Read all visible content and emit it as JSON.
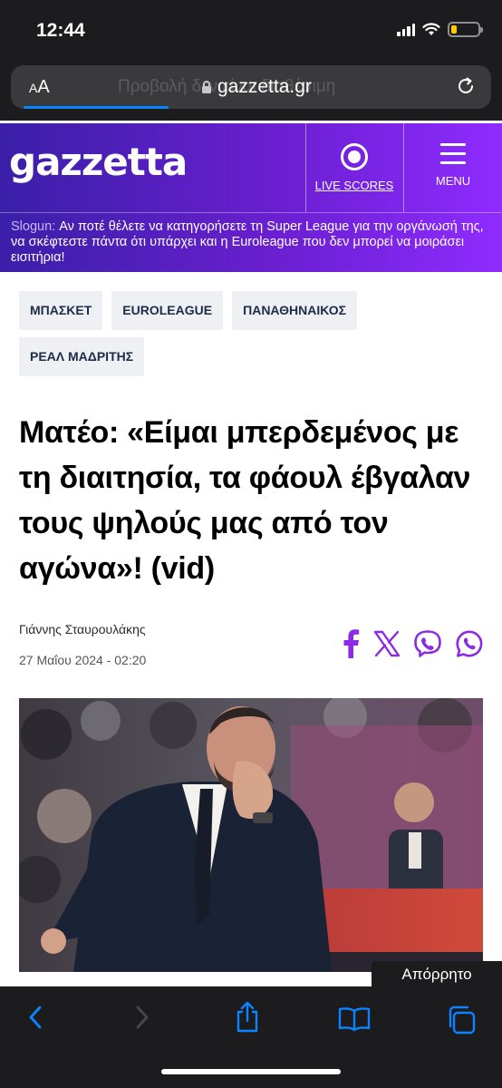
{
  "status_bar": {
    "time": "12:44"
  },
  "browser": {
    "text_size_label": "AA",
    "ghost_text": "Προβολή δεν είναι διαθέσιμη",
    "url": "gazzetta.gr",
    "accent_color": "#0a84ff"
  },
  "site": {
    "logo_text": "gazzetta",
    "live_scores_label": "LIVE SCORES",
    "menu_label": "MENU",
    "slogan_label": "Slogun:",
    "slogan_text": "Αν ποτέ θέλετε να κατηγορήσετε τη Super League για την οργάνωσή της, να σκέφτεστε πάντα ότι υπάρχει και η Euroleague που δεν μπορεί να μοιράσει εισιτήρια!",
    "brand_colors": [
      "#3a1fa8",
      "#8f2bff"
    ]
  },
  "tags": [
    "ΜΠΑΣΚΕΤ",
    "EUROLEAGUE",
    "ΠΑΝΑΘΗΝΑΙΚΟΣ",
    "ΡΕΑΛ ΜΑΔΡΙΤΗΣ"
  ],
  "article": {
    "headline": "Ματέο: «Είμαι μπερδεμένος με τη διαιτησία, τα φάουλ έβγαλαν τους ψηλούς μας από τον αγώνα»! (vid)",
    "author": "Γιάννης Σταυρουλάκης",
    "date": "27 Μαΐου 2024 - 02:20",
    "share_icons": [
      "facebook-icon",
      "x-icon",
      "viber-icon",
      "whatsapp-icon"
    ],
    "share_color": "#8b2be2"
  },
  "privacy_label": "Απόρρητο",
  "toolbar": {
    "icons": [
      "back-icon",
      "forward-icon",
      "share-icon",
      "bookmarks-icon",
      "tabs-icon"
    ]
  }
}
